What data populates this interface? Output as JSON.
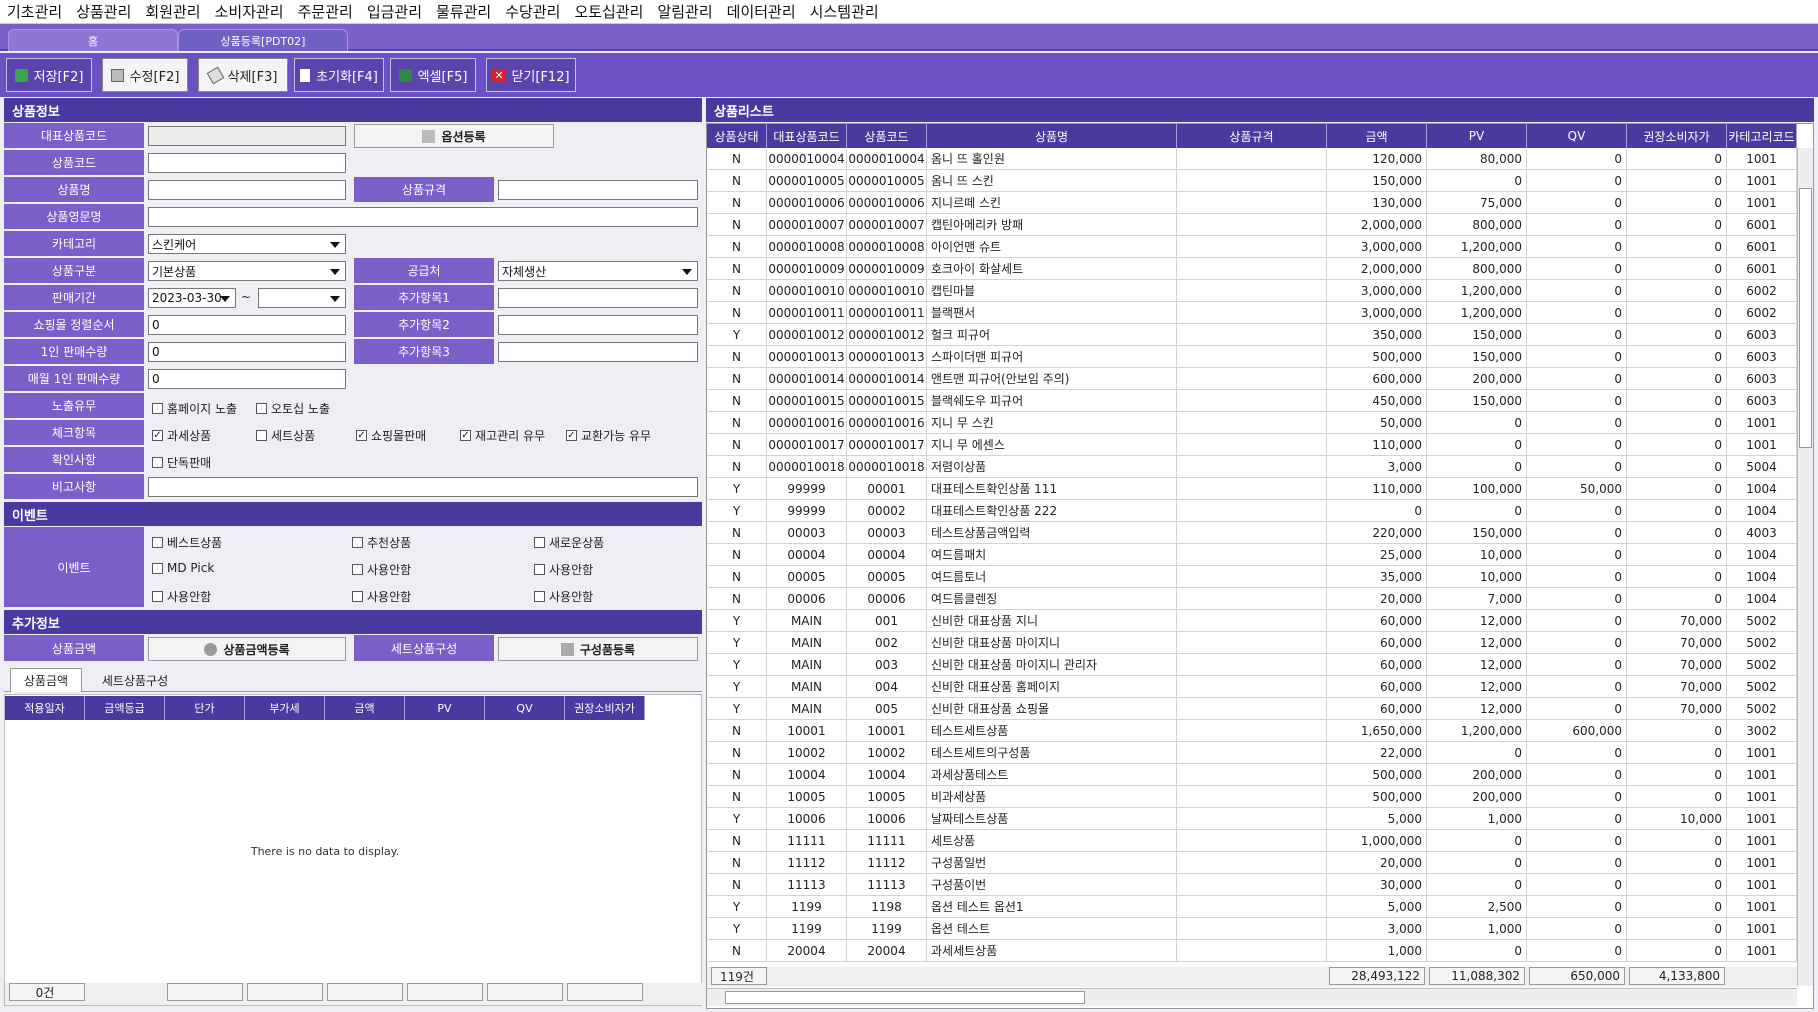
{
  "menu": [
    "기초관리",
    "상품관리",
    "회원관리",
    "소비자관리",
    "주문관리",
    "입금관리",
    "물류관리",
    "수당관리",
    "오토십관리",
    "알림관리",
    "데이터관리",
    "시스템관리"
  ],
  "tabs": {
    "home": "홈",
    "current": "상품등록[PDT02]"
  },
  "toolbar": {
    "save": "저장[F2]",
    "edit": "수정[F2]",
    "delete": "삭제[F3]",
    "reset": "초기화[F4]",
    "excel": "엑셀[F5]",
    "close": "닫기[F12]"
  },
  "form": {
    "section_title": "상품정보",
    "labels": {
      "rep_code": "대표상품코드",
      "code": "상품코드",
      "name": "상품명",
      "eng_name": "상품영문명",
      "category": "카테고리",
      "type": "상품구분",
      "period": "판매기간",
      "sort": "쇼핑몰 정렬순서",
      "per_person": "1인 판매수량",
      "monthly": "매월 1인 판매수량",
      "exposure": "노출유무",
      "check": "체크항목",
      "confirm": "확인사항",
      "remark": "비고사항",
      "spec": "상품규격",
      "supplier": "공급처",
      "extra1": "추가항목1",
      "extra2": "추가항목2",
      "extra3": "추가항목3"
    },
    "option_btn": "옵션등록",
    "values": {
      "category": "스킨케어",
      "type": "기본상품",
      "date_from": "2023-03-30",
      "tilde": "~",
      "supplier": "자체생산",
      "sort": "0",
      "per_person": "0",
      "monthly": "0"
    },
    "exposure": [
      {
        "label": "홈페이지 노출",
        "checked": false
      },
      {
        "label": "오토십 노출",
        "checked": false
      }
    ],
    "checks": [
      {
        "label": "과세상품",
        "checked": true
      },
      {
        "label": "세트상품",
        "checked": false
      },
      {
        "label": "쇼핑몰판매",
        "checked": true
      },
      {
        "label": "재고관리 유무",
        "checked": true
      },
      {
        "label": "교환가능 유무",
        "checked": true
      }
    ],
    "confirm": [
      {
        "label": "단독판매",
        "checked": false
      }
    ]
  },
  "event": {
    "section_title": "이벤트",
    "label": "이벤트",
    "items": [
      "베스트상품",
      "추천상품",
      "새로운상품",
      "MD Pick",
      "사용안함",
      "사용안함",
      "사용안함",
      "사용안함",
      "사용안함"
    ]
  },
  "extra": {
    "section_title": "추가정보",
    "price_label": "상품금액",
    "price_btn": "상품금액등록",
    "set_label": "세트상품구성",
    "set_btn": "구성품등록",
    "tabs": [
      "상품금액",
      "세트상품구성"
    ],
    "headers": [
      "적용일자",
      "금액등급",
      "단가",
      "부가세",
      "금액",
      "PV",
      "QV",
      "권장소비자가"
    ],
    "empty": "There is no data to display.",
    "count": "0건"
  },
  "list": {
    "section_title": "상품리스트",
    "headers": [
      "상품상태",
      "대표상품코드",
      "상품코드",
      "상품명",
      "상품규격",
      "금액",
      "PV",
      "QV",
      "권장소비자가",
      "카테고리코드"
    ],
    "rows": [
      [
        "N",
        "0000010004",
        "0000010004",
        "옴니 뜨 홀인원",
        "",
        "120,000",
        "80,000",
        "0",
        "0",
        "1001"
      ],
      [
        "N",
        "0000010005",
        "0000010005",
        "옴니 뜨 스킨",
        "",
        "150,000",
        "0",
        "0",
        "0",
        "1001"
      ],
      [
        "N",
        "0000010006",
        "0000010006",
        "지니르떼 스킨",
        "",
        "130,000",
        "75,000",
        "0",
        "0",
        "1001"
      ],
      [
        "N",
        "0000010007",
        "0000010007",
        "캡틴아메리카 방패",
        "",
        "2,000,000",
        "800,000",
        "0",
        "0",
        "6001"
      ],
      [
        "N",
        "0000010008",
        "0000010008",
        "아이언맨 슈트",
        "",
        "3,000,000",
        "1,200,000",
        "0",
        "0",
        "6001"
      ],
      [
        "N",
        "0000010009",
        "0000010009",
        "호크아이 화살세트",
        "",
        "2,000,000",
        "800,000",
        "0",
        "0",
        "6001"
      ],
      [
        "N",
        "0000010010",
        "0000010010",
        "캡틴마블",
        "",
        "3,000,000",
        "1,200,000",
        "0",
        "0",
        "6002"
      ],
      [
        "N",
        "0000010011",
        "0000010011",
        "블랙팬서",
        "",
        "3,000,000",
        "1,200,000",
        "0",
        "0",
        "6002"
      ],
      [
        "Y",
        "0000010012",
        "0000010012",
        "헐크 피규어",
        "",
        "350,000",
        "150,000",
        "0",
        "0",
        "6003"
      ],
      [
        "N",
        "0000010013",
        "0000010013",
        "스파이더맨 피규어",
        "",
        "500,000",
        "150,000",
        "0",
        "0",
        "6003"
      ],
      [
        "N",
        "0000010014",
        "0000010014",
        "앤트맨 피규어(안보임 주의)",
        "",
        "600,000",
        "200,000",
        "0",
        "0",
        "6003"
      ],
      [
        "N",
        "0000010015",
        "0000010015",
        "블랙쉐도우 피규어",
        "",
        "450,000",
        "150,000",
        "0",
        "0",
        "6003"
      ],
      [
        "N",
        "0000010016",
        "0000010016",
        "지니 무 스킨",
        "",
        "50,000",
        "0",
        "0",
        "0",
        "1001"
      ],
      [
        "N",
        "0000010017",
        "0000010017",
        "지니 무 에센스",
        "",
        "110,000",
        "0",
        "0",
        "0",
        "1001"
      ],
      [
        "N",
        "0000010018",
        "0000010018",
        "저렴이상품",
        "",
        "3,000",
        "0",
        "0",
        "0",
        "5004"
      ],
      [
        "Y",
        "99999",
        "00001",
        "대표테스트확인상품 111",
        "",
        "110,000",
        "100,000",
        "50,000",
        "0",
        "1004"
      ],
      [
        "Y",
        "99999",
        "00002",
        "대표테스트확인상품 222",
        "",
        "0",
        "0",
        "0",
        "0",
        "1004"
      ],
      [
        "N",
        "00003",
        "00003",
        "테스트상품금액입력",
        "",
        "220,000",
        "150,000",
        "0",
        "0",
        "4003"
      ],
      [
        "N",
        "00004",
        "00004",
        "여드름패치",
        "",
        "25,000",
        "10,000",
        "0",
        "0",
        "1004"
      ],
      [
        "N",
        "00005",
        "00005",
        "여드름토너",
        "",
        "35,000",
        "10,000",
        "0",
        "0",
        "1004"
      ],
      [
        "N",
        "00006",
        "00006",
        "여드름클렌징",
        "",
        "20,000",
        "7,000",
        "0",
        "0",
        "1004"
      ],
      [
        "Y",
        "MAIN",
        "001",
        "신비한 대표상품 지니",
        "",
        "60,000",
        "12,000",
        "0",
        "70,000",
        "5002"
      ],
      [
        "Y",
        "MAIN",
        "002",
        "신비한 대표상품 마이지니",
        "",
        "60,000",
        "12,000",
        "0",
        "70,000",
        "5002"
      ],
      [
        "Y",
        "MAIN",
        "003",
        "신비한 대표상품 마이지니 관리자",
        "",
        "60,000",
        "12,000",
        "0",
        "70,000",
        "5002"
      ],
      [
        "Y",
        "MAIN",
        "004",
        "신비한 대표상품 홈페이지",
        "",
        "60,000",
        "12,000",
        "0",
        "70,000",
        "5002"
      ],
      [
        "Y",
        "MAIN",
        "005",
        "신비한 대표상품 쇼핑몰",
        "",
        "60,000",
        "12,000",
        "0",
        "70,000",
        "5002"
      ],
      [
        "N",
        "10001",
        "10001",
        "테스트세트상품",
        "",
        "1,650,000",
        "1,200,000",
        "600,000",
        "0",
        "3002"
      ],
      [
        "N",
        "10002",
        "10002",
        "테스트세트의구성품",
        "",
        "22,000",
        "0",
        "0",
        "0",
        "1001"
      ],
      [
        "N",
        "10004",
        "10004",
        "과세상품테스트",
        "",
        "500,000",
        "200,000",
        "0",
        "0",
        "1001"
      ],
      [
        "N",
        "10005",
        "10005",
        "비과세상품",
        "",
        "500,000",
        "200,000",
        "0",
        "0",
        "1001"
      ],
      [
        "Y",
        "10006",
        "10006",
        "날짜테스트상품",
        "",
        "5,000",
        "1,000",
        "0",
        "10,000",
        "1001"
      ],
      [
        "N",
        "11111",
        "11111",
        "세트상품",
        "",
        "1,000,000",
        "0",
        "0",
        "0",
        "1001"
      ],
      [
        "N",
        "11112",
        "11112",
        "구성품일번",
        "",
        "20,000",
        "0",
        "0",
        "0",
        "1001"
      ],
      [
        "N",
        "11113",
        "11113",
        "구성품이번",
        "",
        "30,000",
        "0",
        "0",
        "0",
        "1001"
      ],
      [
        "Y",
        "1199",
        "1198",
        "옵션 테스트 옵션1",
        "",
        "5,000",
        "2,500",
        "0",
        "0",
        "1001"
      ],
      [
        "Y",
        "1199",
        "1199",
        "옵션 테스트",
        "",
        "3,000",
        "1,000",
        "0",
        "0",
        "1001"
      ],
      [
        "N",
        "20004",
        "20004",
        "과세세트상품",
        "",
        "1,000",
        "0",
        "0",
        "0",
        "1001"
      ]
    ],
    "footer": {
      "count": "119건",
      "amount": "28,493,122",
      "pv": "11,088,302",
      "qv": "650,000",
      "msrp": "4,133,800"
    }
  }
}
